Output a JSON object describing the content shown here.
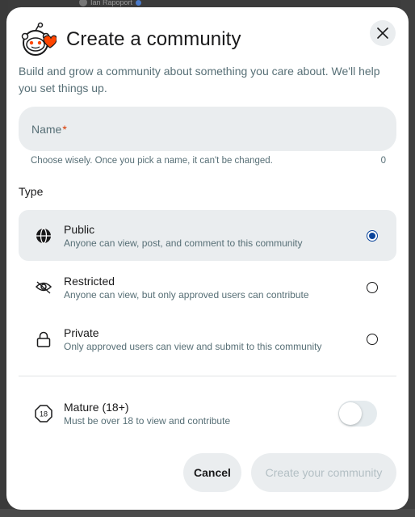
{
  "background": {
    "top_user_name": "Ian Rapoport"
  },
  "modal": {
    "title": "Create a community",
    "subtitle": "Build and grow a community about something you care about. We'll help you set things up.",
    "name_field": {
      "label": "Name",
      "required_mark": "*",
      "helper": "Choose wisely. Once you pick a name, it can't be changed.",
      "char_count": "0"
    },
    "type_heading": "Type",
    "types": [
      {
        "title": "Public",
        "description": "Anyone can view, post, and comment to this community",
        "icon": "globe-icon",
        "selected": true
      },
      {
        "title": "Restricted",
        "description": "Anyone can view, but only approved users can contribute",
        "icon": "eye-icon",
        "selected": false
      },
      {
        "title": "Private",
        "description": "Only approved users can view and submit to this community",
        "icon": "lock-icon",
        "selected": false
      }
    ],
    "mature": {
      "title": "Mature (18+)",
      "description": "Must be over 18 to view and contribute",
      "icon": "eighteen-plus-icon",
      "enabled": false
    },
    "cancel_label": "Cancel",
    "create_label": "Create your community",
    "colors": {
      "selected_radio": "#0a449b",
      "secondary_text": "#576f76",
      "required": "#d93a00",
      "logo_orange": "#ff4500"
    }
  }
}
